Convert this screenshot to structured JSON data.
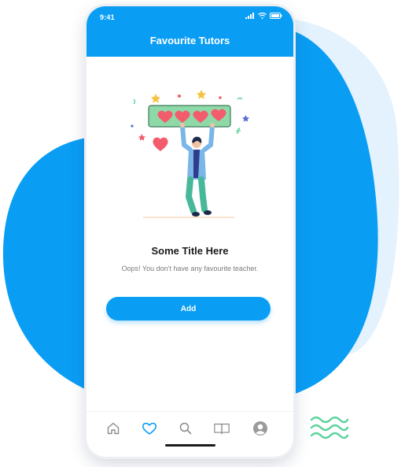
{
  "status": {
    "time": "9:41"
  },
  "header": {
    "title": "Favourite Tutors"
  },
  "empty_state": {
    "title": "Some Title Here",
    "message": "Oops! You don't have any favourite teacher.",
    "illustration": "person-holding-heart-rating-sign"
  },
  "actions": {
    "add_label": "Add"
  },
  "tabbar": {
    "items": [
      {
        "name": "home",
        "icon": "home-icon",
        "active": false
      },
      {
        "name": "favourites",
        "icon": "heart-icon",
        "active": true
      },
      {
        "name": "search",
        "icon": "search-icon",
        "active": false
      },
      {
        "name": "library",
        "icon": "book-icon",
        "active": false
      },
      {
        "name": "profile",
        "icon": "avatar-icon",
        "active": false
      }
    ]
  },
  "colors": {
    "primary": "#0a9df4",
    "blob_light": "#e3f2fd",
    "heart": "#f25c6c",
    "sign_green": "#8fd9a8",
    "decor_green": "#5fd3a0",
    "text_dark": "#1b1b1b",
    "text_muted": "#7b7b7b",
    "icon_gray": "#8a8a8a"
  }
}
